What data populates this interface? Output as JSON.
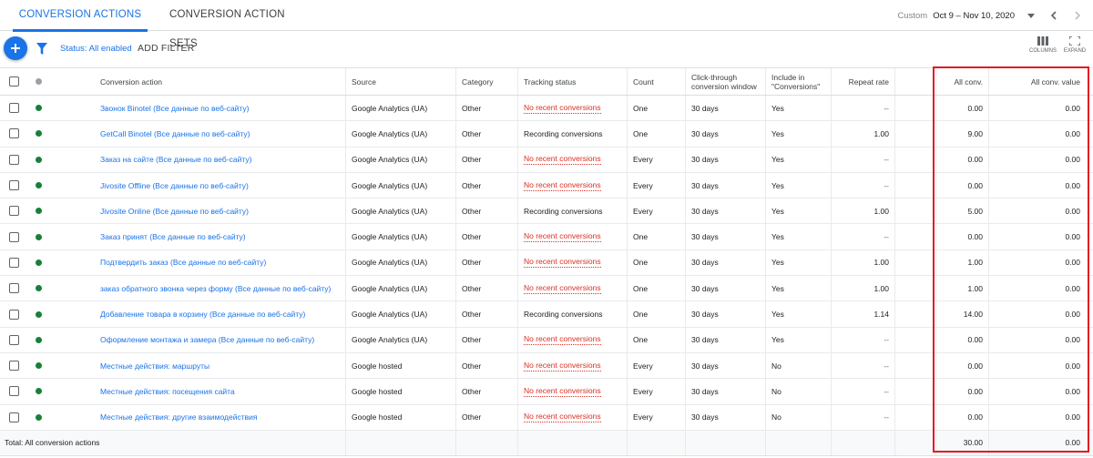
{
  "tabs": [
    {
      "label": "Conversion actions",
      "active": true
    },
    {
      "label": "Conversion action sets",
      "active": false
    }
  ],
  "date_range": {
    "label": "Custom",
    "value": "Oct 9 – Nov 10, 2020"
  },
  "toolbar": {
    "status_text": "Status: All enabled",
    "add_filter": "ADD FILTER",
    "columns_label": "COLUMNS",
    "expand_label": "EXPAND"
  },
  "columns": {
    "name": "Conversion action",
    "source": "Source",
    "category": "Category",
    "tracking": "Tracking status",
    "count": "Count",
    "click": "Click-through conversion window",
    "include": "Include in \"Conversions\"",
    "repeat": "Repeat rate",
    "all_conv": "All conv.",
    "all_value": "All conv. value"
  },
  "rows": [
    {
      "name": "Звонок Binotel (Все данные по веб-сайту)",
      "source": "Google Analytics (UA)",
      "category": "Other",
      "tracking": "No recent conversions",
      "count": "One",
      "click": "30 days",
      "include": "Yes",
      "repeat": "--",
      "all_conv": "0.00",
      "all_value": "0.00"
    },
    {
      "name": "GetCall Binotel (Все данные по веб-сайту)",
      "source": "Google Analytics (UA)",
      "category": "Other",
      "tracking": "Recording conversions",
      "count": "One",
      "click": "30 days",
      "include": "Yes",
      "repeat": "1.00",
      "all_conv": "9.00",
      "all_value": "0.00"
    },
    {
      "name": "Заказ на сайте (Все данные по веб-сайту)",
      "source": "Google Analytics (UA)",
      "category": "Other",
      "tracking": "No recent conversions",
      "count": "Every",
      "click": "30 days",
      "include": "Yes",
      "repeat": "--",
      "all_conv": "0.00",
      "all_value": "0.00"
    },
    {
      "name": "Jivosite Offline (Все данные по веб-сайту)",
      "source": "Google Analytics (UA)",
      "category": "Other",
      "tracking": "No recent conversions",
      "count": "Every",
      "click": "30 days",
      "include": "Yes",
      "repeat": "--",
      "all_conv": "0.00",
      "all_value": "0.00"
    },
    {
      "name": "Jivosite Online (Все данные по веб-сайту)",
      "source": "Google Analytics (UA)",
      "category": "Other",
      "tracking": "Recording conversions",
      "count": "Every",
      "click": "30 days",
      "include": "Yes",
      "repeat": "1.00",
      "all_conv": "5.00",
      "all_value": "0.00"
    },
    {
      "name": "Заказ принят (Все данные по веб-сайту)",
      "source": "Google Analytics (UA)",
      "category": "Other",
      "tracking": "No recent conversions",
      "count": "One",
      "click": "30 days",
      "include": "Yes",
      "repeat": "--",
      "all_conv": "0.00",
      "all_value": "0.00"
    },
    {
      "name": "Подтвердить заказ (Все данные по веб-сайту)",
      "source": "Google Analytics (UA)",
      "category": "Other",
      "tracking": "No recent conversions",
      "count": "One",
      "click": "30 days",
      "include": "Yes",
      "repeat": "1.00",
      "all_conv": "1.00",
      "all_value": "0.00"
    },
    {
      "name": "заказ обратного звонка через форму (Все данные по веб-сайту)",
      "source": "Google Analytics (UA)",
      "category": "Other",
      "tracking": "No recent conversions",
      "count": "One",
      "click": "30 days",
      "include": "Yes",
      "repeat": "1.00",
      "all_conv": "1.00",
      "all_value": "0.00"
    },
    {
      "name": "Добавление товара в корзину (Все данные по веб-сайту)",
      "source": "Google Analytics (UA)",
      "category": "Other",
      "tracking": "Recording conversions",
      "count": "One",
      "click": "30 days",
      "include": "Yes",
      "repeat": "1.14",
      "all_conv": "14.00",
      "all_value": "0.00"
    },
    {
      "name": "Оформление монтажа и замера (Все данные по веб-сайту)",
      "source": "Google Analytics (UA)",
      "category": "Other",
      "tracking": "No recent conversions",
      "count": "One",
      "click": "30 days",
      "include": "Yes",
      "repeat": "--",
      "all_conv": "0.00",
      "all_value": "0.00"
    },
    {
      "name": "Местные действия: маршруты",
      "source": "Google hosted",
      "category": "Other",
      "tracking": "No recent conversions",
      "count": "Every",
      "click": "30 days",
      "include": "No",
      "repeat": "--",
      "all_conv": "0.00",
      "all_value": "0.00"
    },
    {
      "name": "Местные действия: посещения сайта",
      "source": "Google hosted",
      "category": "Other",
      "tracking": "No recent conversions",
      "count": "Every",
      "click": "30 days",
      "include": "No",
      "repeat": "--",
      "all_conv": "0.00",
      "all_value": "0.00"
    },
    {
      "name": "Местные действия: другие взаимодействия",
      "source": "Google hosted",
      "category": "Other",
      "tracking": "No recent conversions",
      "count": "Every",
      "click": "30 days",
      "include": "No",
      "repeat": "--",
      "all_conv": "0.00",
      "all_value": "0.00"
    }
  ],
  "total": {
    "label": "Total: All conversion actions",
    "all_conv": "30.00",
    "all_value": "0.00"
  },
  "colors": {
    "accent": "#1a73e8",
    "warning": "#d93025",
    "enabled": "#188038",
    "highlight": "#e21c23"
  }
}
